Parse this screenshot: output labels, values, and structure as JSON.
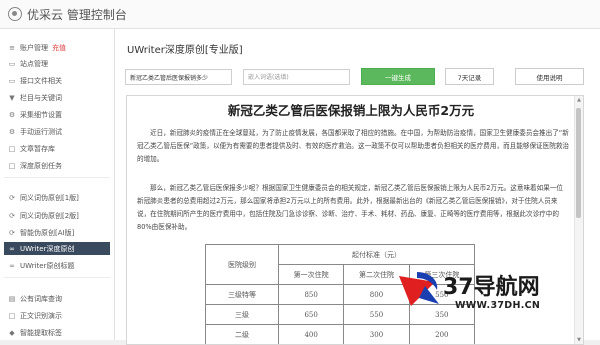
{
  "app": {
    "title": "优采云 管理控制台"
  },
  "sidebar": {
    "items": [
      {
        "label": "账户管理",
        "tag": "充值",
        "icon": "bars-icon"
      },
      {
        "label": "站点管理",
        "icon": "window-icon"
      },
      {
        "label": "接口文件相关",
        "icon": "window-icon"
      },
      {
        "label": "栏目与关键词",
        "icon": "filter-icon"
      },
      {
        "label": "采集细节设置",
        "icon": "gear-icon"
      },
      {
        "label": "手动运行测试",
        "icon": "gear-icon"
      },
      {
        "label": "文章暂存库",
        "icon": "square-icon"
      },
      {
        "label": "深度原创任务",
        "icon": "square-icon"
      },
      {
        "label": "同义词伪原创[1版]",
        "icon": "refresh-icon"
      },
      {
        "label": "同义词伪原创[2版]",
        "icon": "refresh-icon"
      },
      {
        "label": "智能伪原创[AI版]",
        "icon": "refresh-icon"
      },
      {
        "label": "UWriter深度原创",
        "icon": "link-icon"
      },
      {
        "label": "UWriter原创标题",
        "icon": "link-icon"
      },
      {
        "label": "公有词库查询",
        "icon": "book-icon"
      },
      {
        "label": "正文识别演示",
        "icon": "square-icon"
      },
      {
        "label": "智能提取标签",
        "icon": "tag-icon"
      }
    ]
  },
  "main": {
    "page_title": "UWriter深度原创[专业版]",
    "title_input": {
      "value": "新冠乙类乙管后医保报销多少"
    },
    "keyword_input": {
      "placeholder": "嵌入词语(选填)"
    },
    "generate_button": "一键生成",
    "history_button": "7天记录",
    "help_button": "使用说明"
  },
  "article": {
    "title": "新冠乙类乙管后医保报销上限为人民币2万元",
    "paragraphs": [
      "近日，新冠肺炎的疫情正在全球蔓延，为了防止疫情发展，各国都采取了相应的措施。在中国，为帮助防治疫情，国家卫生健康委员会推出了“新冠乙类乙管后医保”政策，以便为有需要的患者提供及时、有效的医疗救治。这一政策不仅可以帮助患者负担相关的医疗费用，而且能够保证医院救治的增加。",
      "那么，新冠乙类乙管后医保报多少呢？根据国家卫生健康委员会的相关规定，新冠乙类乙管后医保报销上限为人民币2万元。这意味着如果一位新冠肺炎患者的总费用超过2万元，那么国家将承担2万元以上的所有费用。此外，根据最新出台的《新冠乙类乙管后医保报销》，对于住院人员来说，在住院期间所产生的医疗费用中，包括住院及门急诊诊察、诊断、治疗、手术、耗材、药品、康复、正畸等的医疗费用等，根据此次诊疗中的80%由医保补助。"
    ],
    "table": {
      "col_header_left": "医院级别",
      "col_header_group": "起付标准（元）",
      "col_headers": [
        "第一次住院",
        "第二次住院",
        "第三次住院"
      ],
      "rows": [
        {
          "level": "三级特等",
          "values": [
            "850",
            "800",
            "550"
          ]
        },
        {
          "level": "三级",
          "values": [
            "650",
            "550",
            "350"
          ]
        },
        {
          "level": "二级",
          "values": [
            "400",
            "300",
            "200"
          ]
        }
      ]
    }
  },
  "watermark": {
    "name": "37导航网",
    "url": "WWW.37DH.CN",
    "colors": {
      "red": "#e02020",
      "blue": "#1a3fb0"
    }
  },
  "colors": {
    "accent_green": "#5cb85c",
    "sidebar_active": "#3a4a5e",
    "tag_red": "#e04040"
  }
}
